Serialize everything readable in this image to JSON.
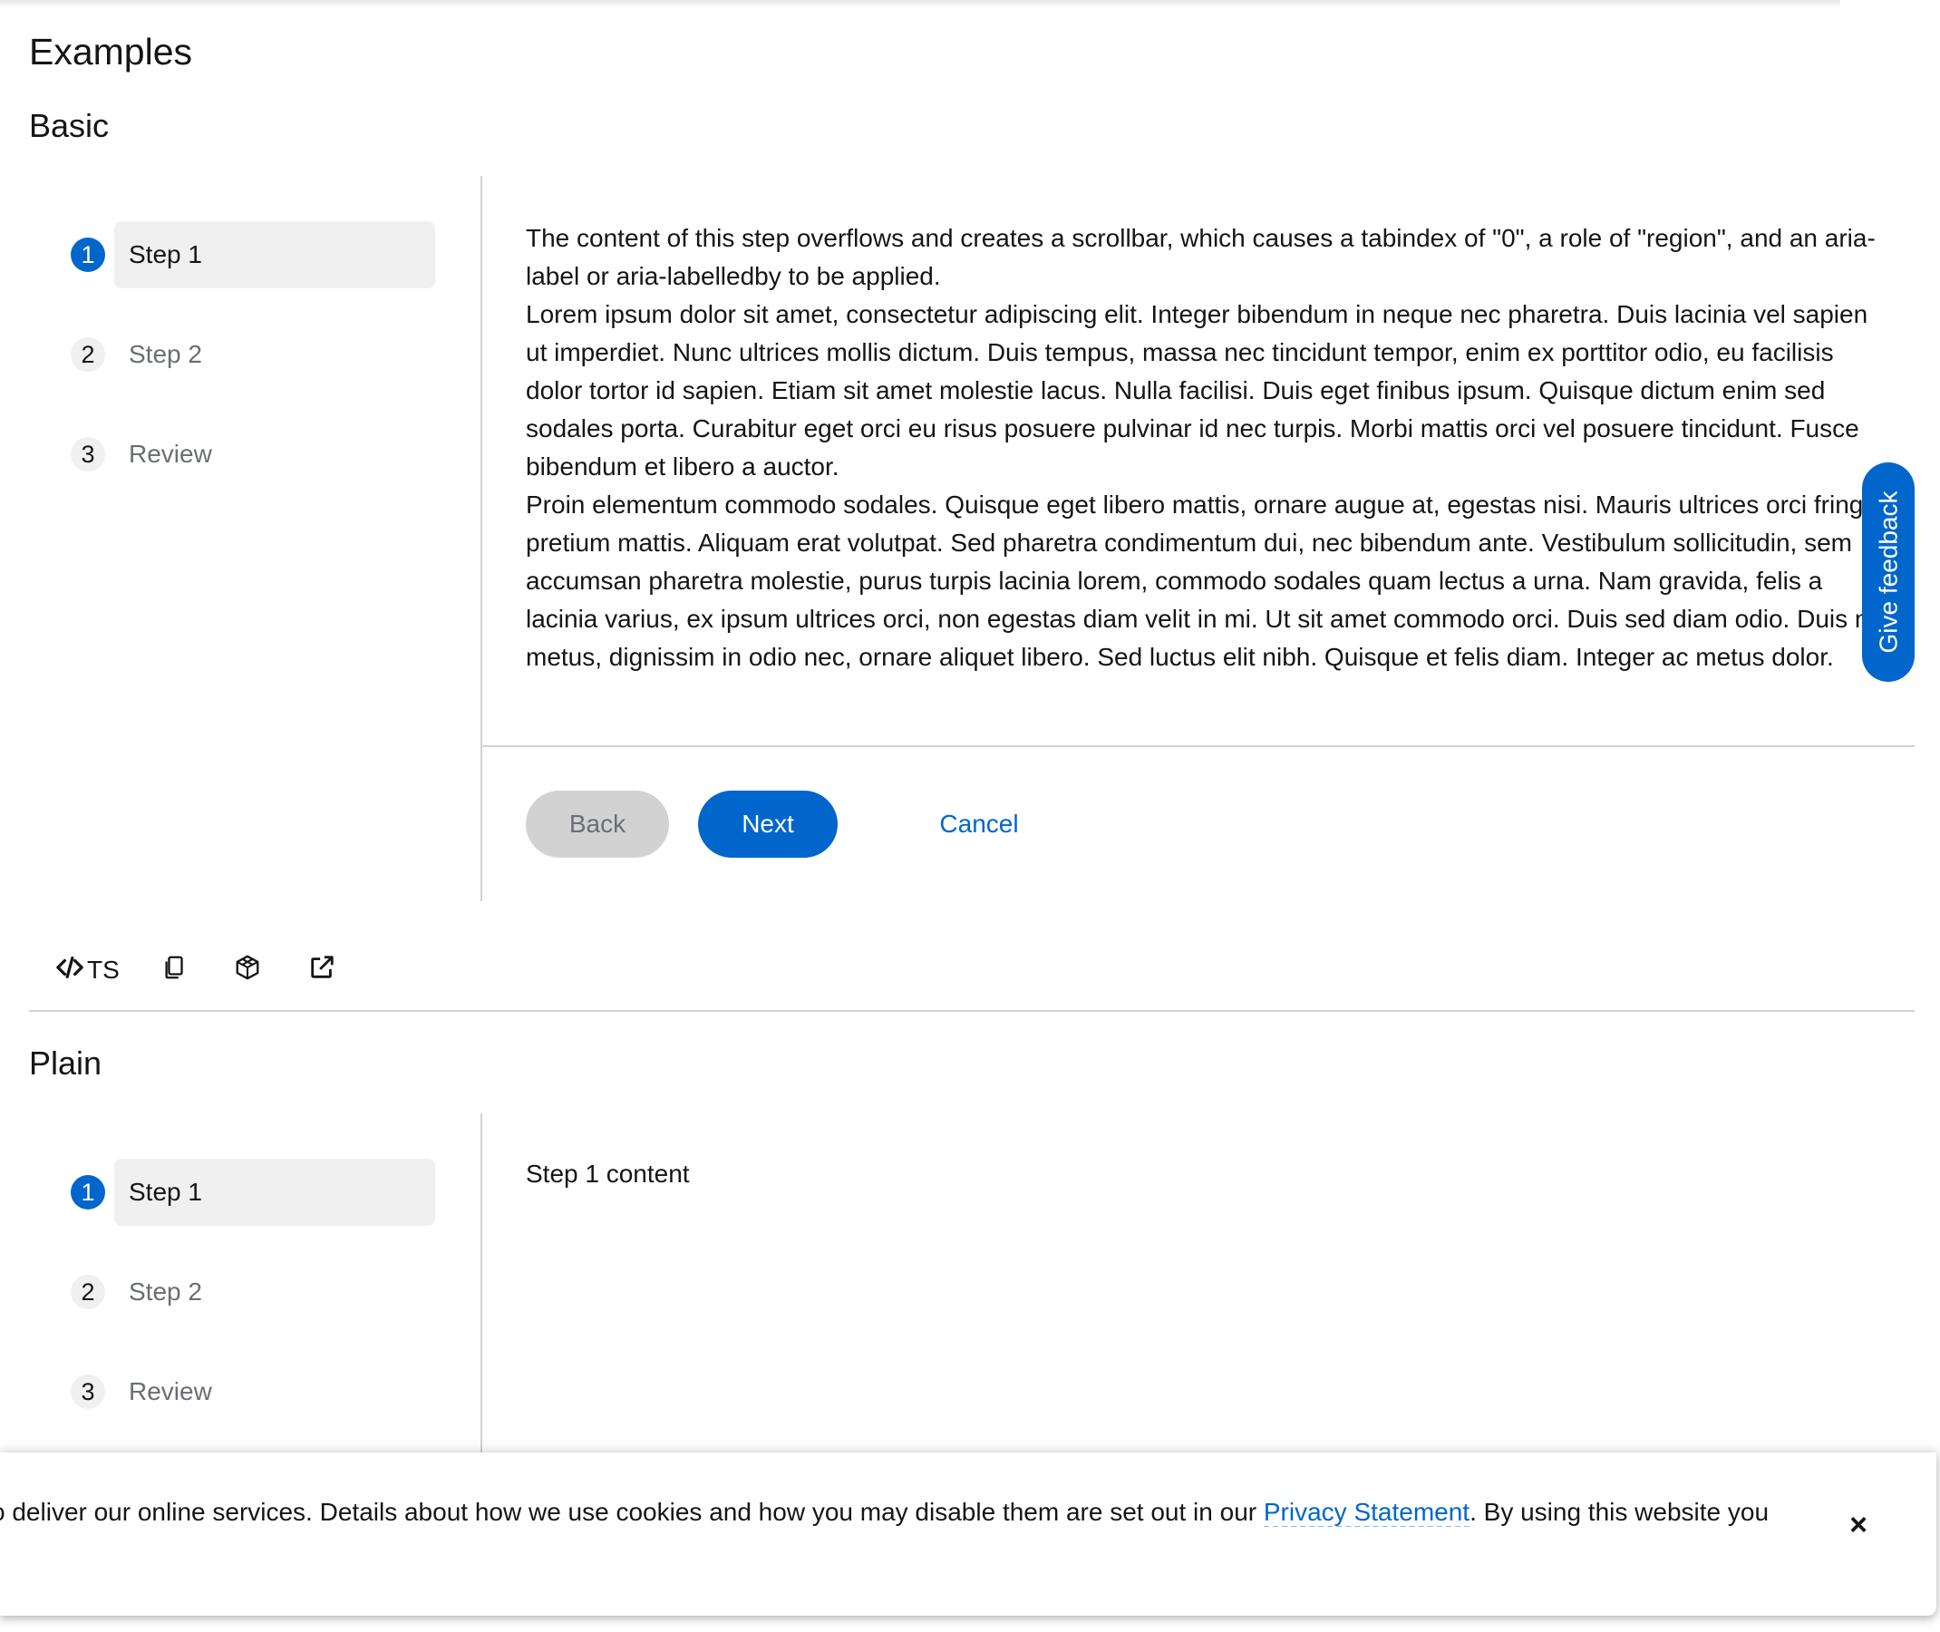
{
  "headings": {
    "examples": "Examples",
    "basic": "Basic",
    "plain": "Plain"
  },
  "basic_wizard": {
    "steps": [
      {
        "number": "1",
        "label": "Step 1"
      },
      {
        "number": "2",
        "label": "Step 2"
      },
      {
        "number": "3",
        "label": "Review"
      }
    ],
    "paragraphs": [
      "The content of this step overflows and creates a scrollbar, which causes a tabindex of \"0\", a role of \"region\", and an aria-label or aria-labelledby to be applied.",
      "Lorem ipsum dolor sit amet, consectetur adipiscing elit. Integer bibendum in neque nec pharetra. Duis lacinia vel sapien ut imperdiet. Nunc ultrices mollis dictum. Duis tempus, massa nec tincidunt tempor, enim ex porttitor odio, eu facilisis dolor tortor id sapien. Etiam sit amet molestie lacus. Nulla facilisi. Duis eget finibus ipsum. Quisque dictum enim sed sodales porta. Curabitur eget orci eu risus posuere pulvinar id nec turpis. Morbi mattis orci vel posuere tincidunt. Fusce bibendum et libero a auctor.",
      "Proin elementum commodo sodales. Quisque eget libero mattis, ornare augue at, egestas nisi. Mauris ultrices orci fringilla pretium mattis. Aliquam erat volutpat. Sed pharetra condimentum dui, nec bibendum ante. Vestibulum sollicitudin, sem accumsan pharetra molestie, purus turpis lacinia lorem, commodo sodales quam lectus a urna. Nam gravida, felis a lacinia varius, ex ipsum ultrices orci, non egestas diam velit in mi. Ut sit amet commodo orci. Duis sed diam odio. Duis mi metus, dignissim in odio nec, ornare aliquet libero. Sed luctus elit nibh. Quisque et felis diam. Integer ac metus dolor."
    ],
    "buttons": {
      "back": "Back",
      "next": "Next",
      "cancel": "Cancel"
    }
  },
  "toolbar": {
    "code_label": "TS",
    "icons": [
      "code-icon",
      "copy-icon",
      "codesandbox-icon",
      "external-link-icon"
    ]
  },
  "plain_wizard": {
    "steps": [
      {
        "number": "1",
        "label": "Step 1"
      },
      {
        "number": "2",
        "label": "Step 2"
      },
      {
        "number": "3",
        "label": "Review"
      }
    ],
    "content": "Step 1 content"
  },
  "feedback": {
    "label": "Give feedback"
  },
  "cookie": {
    "text_before": "o deliver our online services. Details about how we use cookies and how you may disable them are set out in our ",
    "link": "Privacy Statement",
    "text_after": ". By using this website you",
    "close": "×"
  },
  "colors": {
    "accent": "#0066cc",
    "nav_current_bg": "#f0f0f0",
    "disabled_button": "#d2d2d2",
    "divider": "#d2d2d2"
  }
}
